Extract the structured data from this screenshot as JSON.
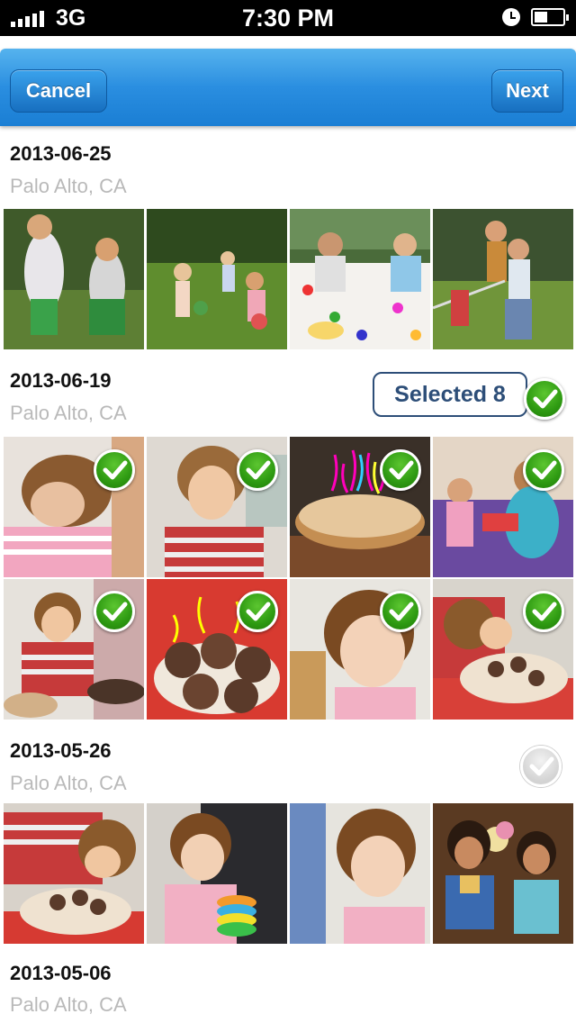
{
  "status_bar": {
    "network": "3G",
    "time": "7:30 PM"
  },
  "nav": {
    "cancel_label": "Cancel",
    "next_label": "Next"
  },
  "selected_badge": "Selected 8",
  "colors": {
    "nav_blue": "#2a8ee0",
    "check_green": "#3aa81a",
    "badge_navy": "#2d4e78",
    "location_grey": "#b9b9b9"
  },
  "sections": [
    {
      "date": "2013-06-25",
      "location": "Palo Alto, CA",
      "photos": [
        {
          "scene": "girls-running-outdoors",
          "selected": false
        },
        {
          "scene": "kids-playing-on-lawn",
          "selected": false
        },
        {
          "scene": "kids-at-party-table",
          "selected": false
        },
        {
          "scene": "kids-tug-of-war",
          "selected": false
        }
      ]
    },
    {
      "date": "2013-06-19",
      "location": "Palo Alto, CA",
      "photos": [
        {
          "scene": "child-hugging-adult",
          "selected": true
        },
        {
          "scene": "boy-in-striped-shirt",
          "selected": true
        },
        {
          "scene": "birthday-cake-candles",
          "selected": true
        },
        {
          "scene": "girl-at-party-table",
          "selected": true
        },
        {
          "scene": "boy-with-cakes",
          "selected": true
        },
        {
          "scene": "cookie-cake-closeup",
          "selected": true
        },
        {
          "scene": "toddler-portrait",
          "selected": true
        },
        {
          "scene": "boy-blowing-candles",
          "selected": true
        }
      ]
    },
    {
      "date": "2013-05-26",
      "location": "Palo Alto, CA",
      "photos": [
        {
          "scene": "boy-with-cake",
          "selected": false
        },
        {
          "scene": "toddler-with-toy-rings",
          "selected": false
        },
        {
          "scene": "toddler-looking-left",
          "selected": false
        },
        {
          "scene": "girls-in-costumes",
          "selected": false
        }
      ]
    },
    {
      "date": "2013-05-06",
      "location": "Palo Alto, CA",
      "photos": []
    }
  ]
}
